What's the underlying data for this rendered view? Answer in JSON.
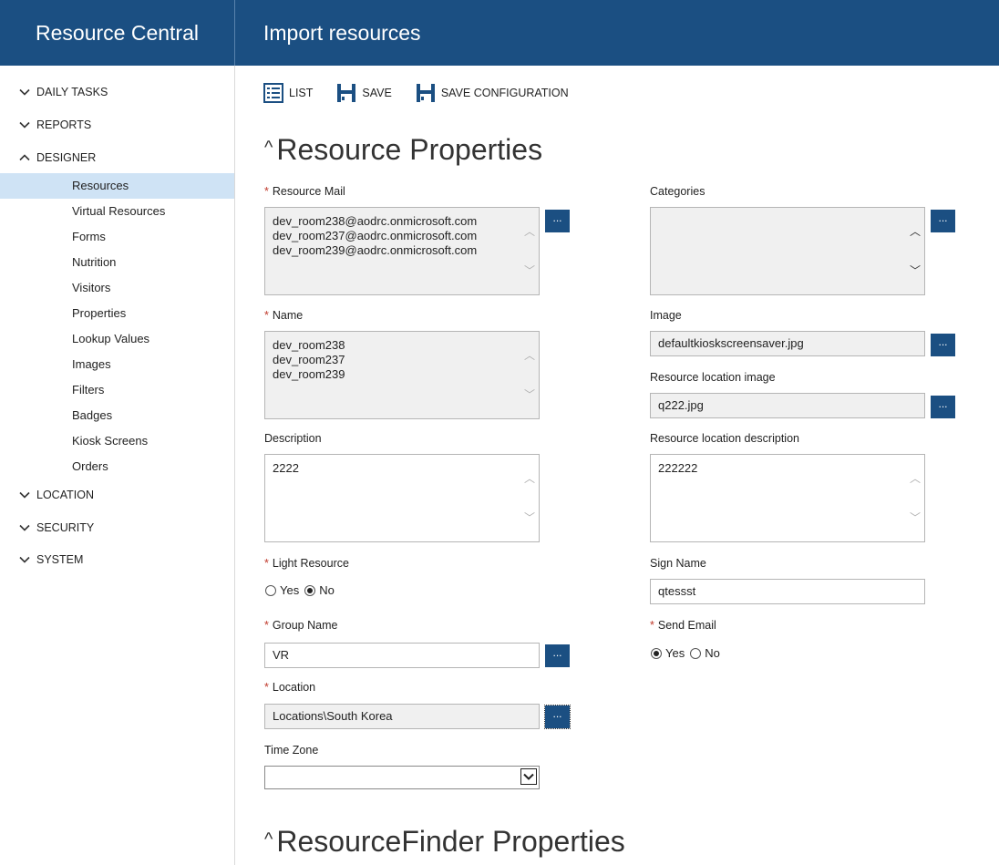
{
  "app": {
    "title": "Resource Central",
    "page_title": "Import resources"
  },
  "sidebar": {
    "sections": [
      {
        "label": "DAILY TASKS",
        "expanded": false
      },
      {
        "label": "REPORTS",
        "expanded": false
      },
      {
        "label": "DESIGNER",
        "expanded": true
      },
      {
        "label": "LOCATION",
        "expanded": false
      },
      {
        "label": "SECURITY",
        "expanded": false
      },
      {
        "label": "SYSTEM",
        "expanded": false
      }
    ],
    "designer_items": [
      "Resources",
      "Virtual Resources",
      "Forms",
      "Nutrition",
      "Visitors",
      "Properties",
      "Lookup Values",
      "Images",
      "Filters",
      "Badges",
      "Kiosk Screens",
      "Orders"
    ],
    "active_item": "Resources"
  },
  "toolbar": {
    "list_label": "LIST",
    "save_label": "SAVE",
    "save_config_label": "SAVE CONFIGURATION"
  },
  "sections": {
    "resource_properties": "Resource Properties",
    "resourcefinder_properties": "ResourceFinder Properties"
  },
  "form": {
    "required_marker": "*",
    "browse_label": "...",
    "resource_mail": {
      "label": "Resource Mail",
      "values": [
        "dev_room238@aodrc.onmicrosoft.com",
        "dev_room237@aodrc.onmicrosoft.com",
        "dev_room239@aodrc.onmicrosoft.com"
      ]
    },
    "name": {
      "label": "Name",
      "values": [
        "dev_room238",
        "dev_room237",
        "dev_room239"
      ]
    },
    "description": {
      "label": "Description",
      "value": "2222"
    },
    "light_resource": {
      "label": "Light Resource",
      "options": [
        "Yes",
        "No"
      ],
      "selected": "No"
    },
    "group_name": {
      "label": "Group Name",
      "value": "VR"
    },
    "location": {
      "label": "Location",
      "value": "Locations\\South Korea"
    },
    "time_zone": {
      "label": "Time Zone",
      "value": ""
    },
    "categories": {
      "label": "Categories",
      "value": ""
    },
    "image": {
      "label": "Image",
      "value": "defaultkioskscreensaver.jpg"
    },
    "resource_location_image": {
      "label": "Resource location image",
      "value": "q222.jpg"
    },
    "resource_location_description": {
      "label": "Resource location description",
      "value": "222222"
    },
    "sign_name": {
      "label": "Sign Name",
      "value": "qtessst"
    },
    "send_email": {
      "label": "Send Email",
      "options": [
        "Yes",
        "No"
      ],
      "selected": "Yes"
    }
  },
  "colors": {
    "header_bg": "#1b4f82",
    "active_nav_bg": "#cfe3f5",
    "required": "#c0392b"
  },
  "icons": {
    "expand": "chevron-down-icon",
    "collapse": "chevron-up-icon",
    "list": "list-icon",
    "save": "floppy-disk-icon"
  }
}
